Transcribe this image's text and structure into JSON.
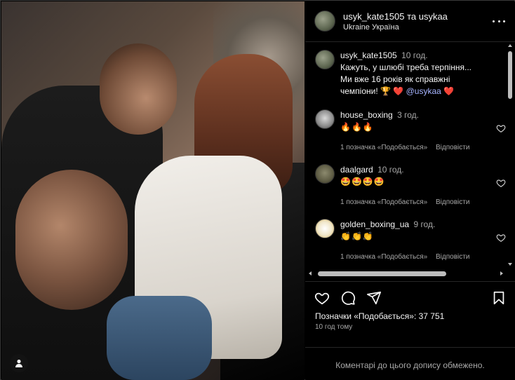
{
  "post": {
    "owner": "usyk_kate1505 та usykaa",
    "location": "Ukraine Україна",
    "likes_text": "Позначки «Подобається»: 37 751",
    "time_ago": "10 год тому",
    "comments_disabled_note": "Коментарі до цього допису обмежено."
  },
  "caption": {
    "user": "usyk_kate1505",
    "time": "10 год.",
    "text_line1": "Кажуть, у шлюбі треба терпіння...",
    "text_line2": "Ми вже 16 років як справжні",
    "text_line3": "чемпіони!",
    "trophy": "🏆",
    "heart1": "❤️",
    "mention": "@usykaa",
    "heart2": "❤️"
  },
  "comments": [
    {
      "user": "house_boxing",
      "time": "3 год.",
      "text": "🔥🔥🔥",
      "likes": "1 позначка «Подобається»",
      "reply": "Відповісти"
    },
    {
      "user": "daalgard",
      "time": "10 год.",
      "text": "🤩🤩🤩🤩",
      "likes": "1 позначка «Подобається»",
      "reply": "Відповісти"
    },
    {
      "user": "golden_boxing_ua",
      "time": "9 год.",
      "text": "👏👏👏",
      "likes": "1 позначка «Подобається»",
      "reply": "Відповісти"
    }
  ],
  "icons": {
    "more": "more-options-icon",
    "like": "heart-icon",
    "comment": "comment-bubble-icon",
    "share": "paper-plane-icon",
    "save": "bookmark-icon",
    "tag": "person-tag-icon"
  },
  "colors": {
    "background": "#000000",
    "mention": "#a6b4ff",
    "muted": "#a8a8a8",
    "heart": "#e0245e"
  }
}
